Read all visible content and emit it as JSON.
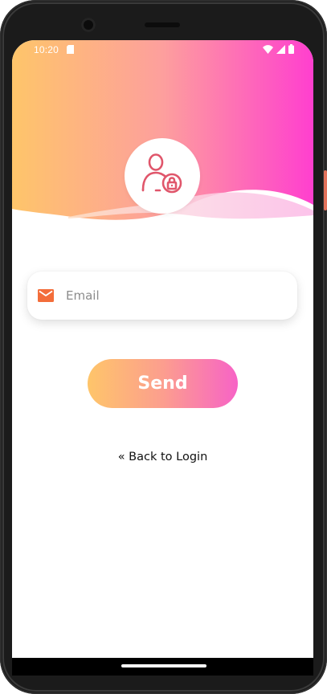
{
  "status_bar": {
    "time": "10:20",
    "sd_icon": "sd-card-icon",
    "wifi_icon": "wifi-icon",
    "signal_icon": "signal-icon",
    "battery_icon": "battery-icon"
  },
  "header": {
    "gradient_start": "#fec56a",
    "gradient_end": "#ff3fcf",
    "avatar_icon": "user-lock-icon",
    "avatar_icon_color": "#e0566b"
  },
  "form": {
    "email_icon": "mail-icon",
    "email_icon_color": "#f36d3a",
    "email_placeholder": "Email",
    "email_value": ""
  },
  "actions": {
    "send_label": "Send",
    "back_label": "« Back to Login"
  }
}
